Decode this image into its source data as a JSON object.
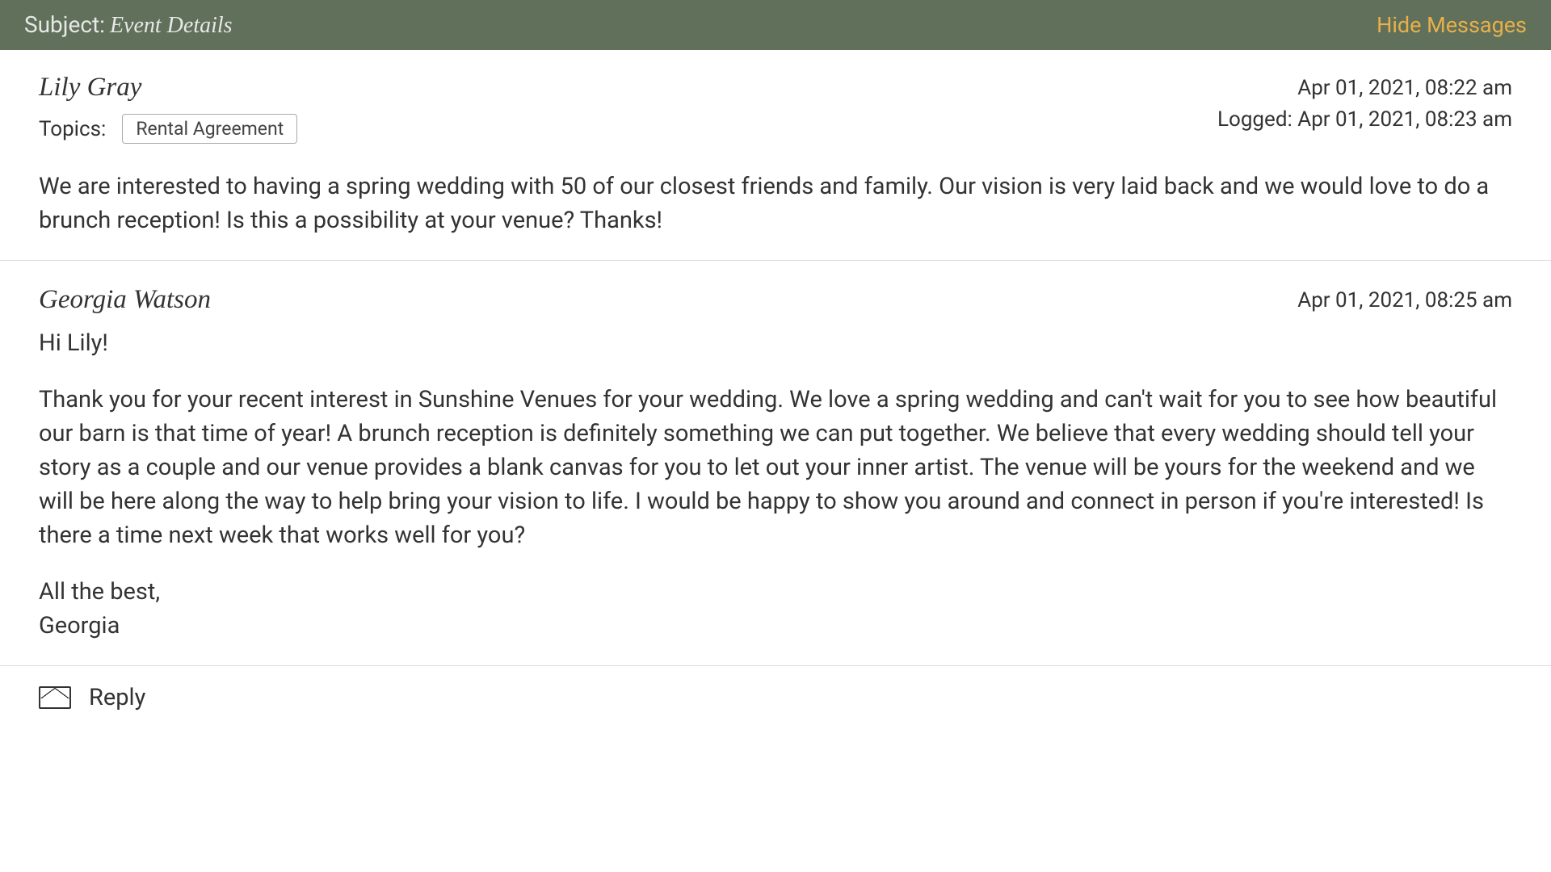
{
  "header": {
    "subject_label": "Subject:",
    "subject_value": "Event Details",
    "hide_messages": "Hide Messages"
  },
  "messages": [
    {
      "sender": "Lily Gray",
      "timestamp": "Apr 01, 2021, 08:22 am",
      "logged": "Logged: Apr 01, 2021, 08:23 am",
      "topics_label": "Topics:",
      "topics": [
        "Rental Agreement"
      ],
      "body": "We are interested to having a spring wedding with 50 of our closest friends and family. Our vision is very laid back and we would love to do a brunch reception! Is this a possibility at your venue? Thanks!"
    },
    {
      "sender": "Georgia Watson",
      "timestamp": "Apr 01, 2021, 08:25 am",
      "greeting": "Hi Lily!",
      "body": "Thank you for your recent interest in Sunshine Venues for your wedding. We love a spring wedding and can't wait for you to see how beautiful our barn is that time of year! A brunch reception is definitely something we can put together. We believe that every wedding should tell your story as a couple and our venue provides a blank canvas for you to let out your inner artist. The venue will be yours for the weekend and we will be here along the way to help bring your vision to life. I would be happy to show you around and connect in person if you're interested! Is there a time next week that works well for you?",
      "signoff": "All the best,",
      "signature": "Georgia"
    }
  ],
  "reply_label": "Reply"
}
